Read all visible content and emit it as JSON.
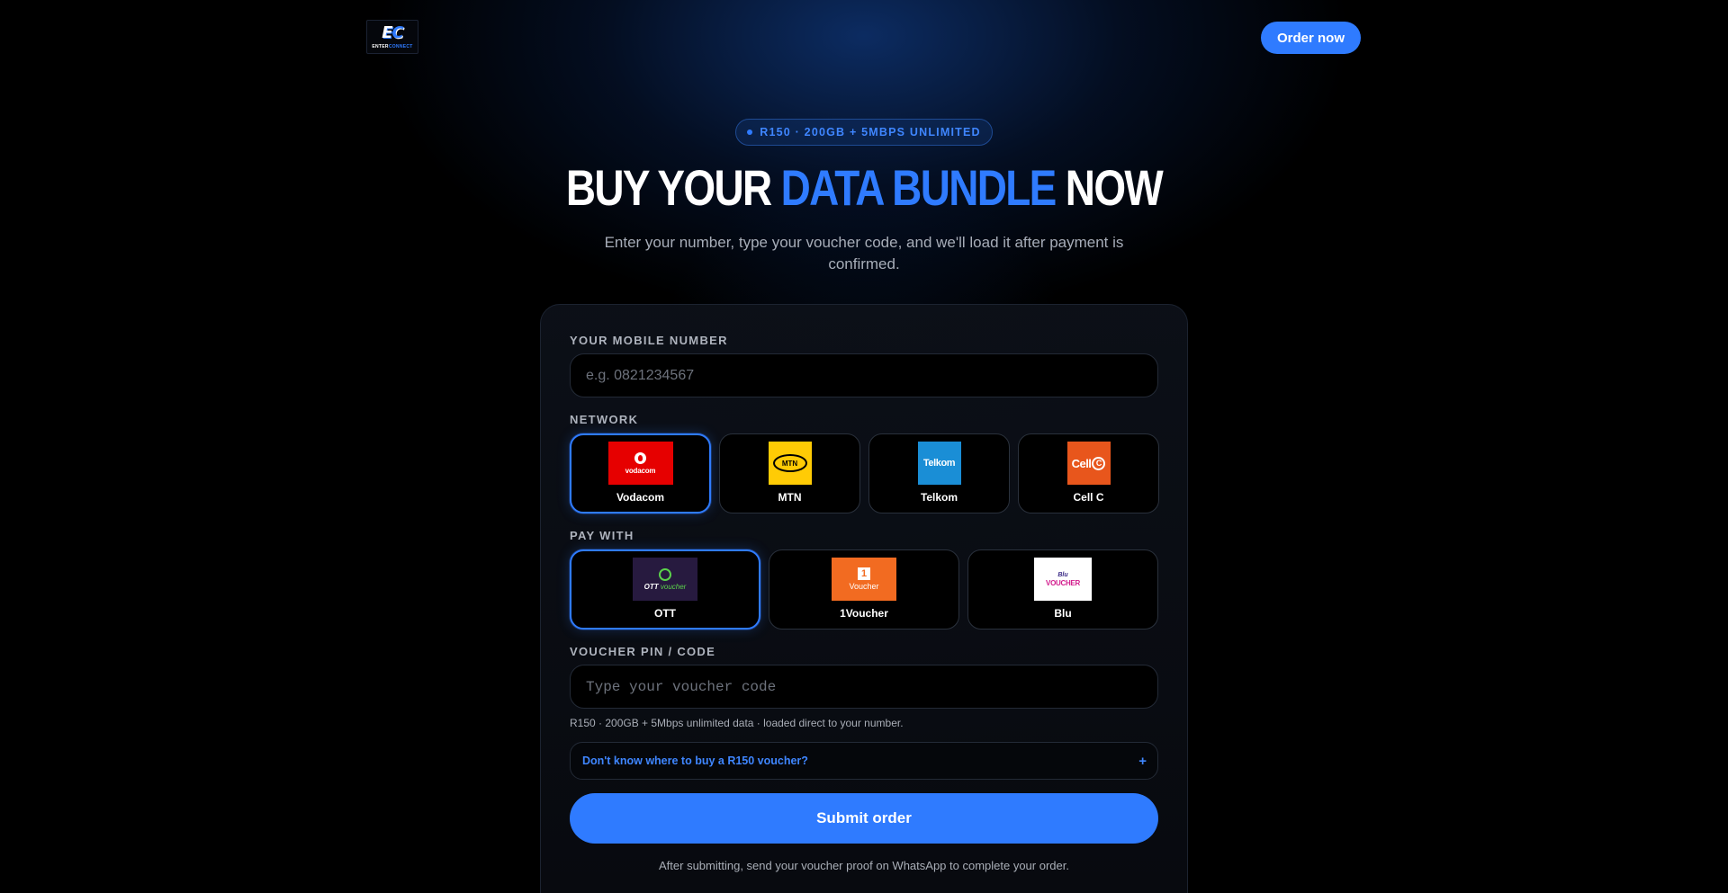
{
  "header": {
    "logo_mark_a": "E",
    "logo_mark_b": "C",
    "logo_text_a": "ENTER",
    "logo_text_b": "CONNECT",
    "order_label": "Order now"
  },
  "hero": {
    "pill": "R150 · 200GB + 5MBPS UNLIMITED",
    "headline_a": "BUY YOUR ",
    "headline_accent": "DATA BUNDLE",
    "headline_b": " NOW",
    "subtitle": "Enter your number, type your voucher code, and we'll load it after payment is confirmed."
  },
  "form": {
    "mobile_label": "YOUR MOBILE NUMBER",
    "mobile_placeholder": "e.g. 0821234567",
    "network_label": "NETWORK",
    "networks": [
      {
        "name": "Vodacom",
        "logo_text": "vodacom",
        "selected": true
      },
      {
        "name": "MTN",
        "logo_text": "MTN",
        "selected": false
      },
      {
        "name": "Telkom",
        "logo_text": "Telkom",
        "selected": false
      },
      {
        "name": "Cell C",
        "logo_text": "Cell",
        "logo_text_b": "C",
        "selected": false
      }
    ],
    "pay_label": "PAY WITH",
    "payments": [
      {
        "name": "OTT",
        "logo_text": "OTT",
        "logo_text_b": "voucher",
        "selected": true
      },
      {
        "name": "1Voucher",
        "logo_text": "1",
        "logo_text_b": "Voucher",
        "selected": false
      },
      {
        "name": "Blu",
        "logo_text": "Blu",
        "logo_text_b": "VOUCHER",
        "selected": false
      }
    ],
    "voucher_label": "VOUCHER PIN / CODE",
    "voucher_placeholder": "Type your voucher code",
    "bundle_note": "R150 · 200GB + 5Mbps unlimited data · loaded direct to your number.",
    "faq_question": "Don't know where to buy a R150 voucher?",
    "faq_icon": "+",
    "submit_label": "Submit order",
    "footnote": "After submitting, send your voucher proof on WhatsApp to complete your order."
  },
  "colors": {
    "accent": "#2f7bff",
    "background": "#000000",
    "card_border": "#1c2330"
  }
}
